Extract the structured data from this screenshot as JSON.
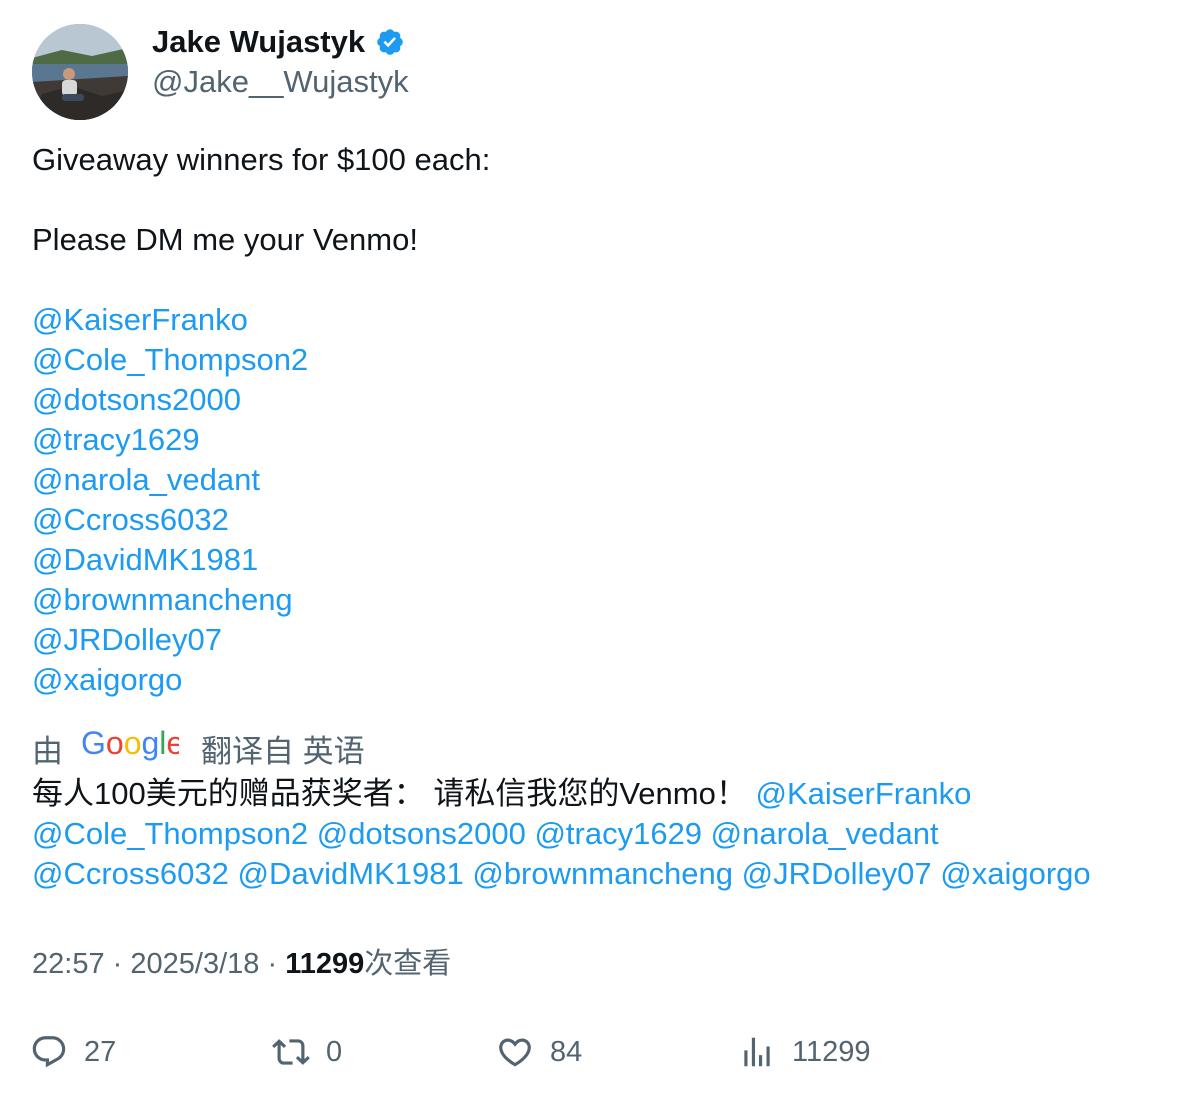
{
  "author": {
    "display_name": "Jake Wujastyk",
    "handle": "@Jake__Wujastyk",
    "verified": true,
    "avatar_icon": "profile-photo"
  },
  "tweet": {
    "lines": [
      "Giveaway winners for $100 each:",
      "",
      "Please DM me your Venmo!",
      ""
    ],
    "mentions": [
      "@KaiserFranko",
      "@Cole_Thompson2",
      "@dotsons2000",
      "@tracy1629",
      "@narola_vedant",
      "@Ccross6032",
      "@DavidMK1981",
      "@brownmancheng",
      "@JRDolley07",
      "@xaigorgo"
    ]
  },
  "translation": {
    "by_label": "由",
    "provider": "Google",
    "from_label": "翻译自 英语",
    "text": "每人100美元的赠品获奖者： 请私信我您的Venmo！"
  },
  "meta": {
    "time": "22:57",
    "date": "2025/3/18",
    "views": "11299",
    "views_label": "次查看",
    "separator": "·"
  },
  "actions": {
    "replies": "27",
    "reposts": "0",
    "likes": "84",
    "views": "11299"
  },
  "colors": {
    "link": "#1d9bf0",
    "secondary_text": "#536471",
    "primary_text": "#0f1419"
  }
}
